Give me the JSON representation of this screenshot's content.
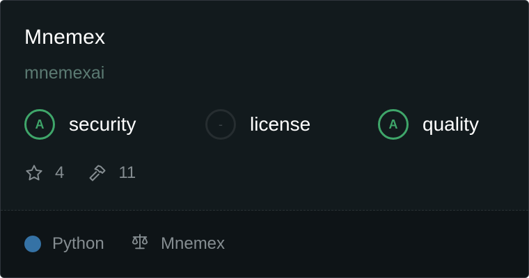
{
  "repo": {
    "name": "Mnemex",
    "owner": "mnemexai"
  },
  "scores": [
    {
      "grade": "A",
      "label": "security",
      "state": "graded"
    },
    {
      "grade": "-",
      "label": "license",
      "state": "ungraded"
    },
    {
      "grade": "A",
      "label": "quality",
      "state": "graded"
    }
  ],
  "stats": {
    "stars": "4",
    "tools": "11",
    "stars_icon": "star-icon",
    "tools_icon": "hammer-icon"
  },
  "footer": {
    "language": "Python",
    "language_color": "#3572a5",
    "license": "Mnemex",
    "license_icon": "scale-icon"
  },
  "colors": {
    "card_background": "#121a1d",
    "footer_background": "#0e1417",
    "grade_a": "#3fa66a",
    "owner_text": "#5b7a72",
    "muted_text": "#858d91"
  }
}
